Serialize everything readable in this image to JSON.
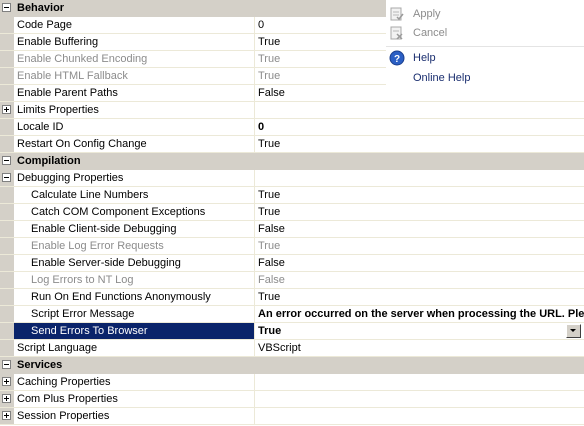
{
  "sections": {
    "behavior": {
      "title": "Behavior",
      "rows": [
        {
          "name": "Code Page",
          "value": "0"
        },
        {
          "name": "Enable Buffering",
          "value": "True"
        },
        {
          "name": "Enable Chunked Encoding",
          "value": "True"
        },
        {
          "name": "Enable HTML Fallback",
          "value": "True"
        },
        {
          "name": "Enable Parent Paths",
          "value": "False"
        },
        {
          "name": "Limits Properties",
          "value": ""
        },
        {
          "name": "Locale ID",
          "value": "0"
        },
        {
          "name": "Restart On Config Change",
          "value": "True"
        }
      ]
    },
    "compilation": {
      "title": "Compilation",
      "group": {
        "name": "Debugging Properties",
        "value": ""
      },
      "rows": [
        {
          "name": "Calculate Line Numbers",
          "value": "True"
        },
        {
          "name": "Catch COM Component Exceptions",
          "value": "True"
        },
        {
          "name": "Enable Client-side Debugging",
          "value": "False"
        },
        {
          "name": "Enable Log Error Requests",
          "value": "True"
        },
        {
          "name": "Enable Server-side Debugging",
          "value": "False"
        },
        {
          "name": "Log Errors to NT Log",
          "value": "False"
        },
        {
          "name": "Run On End Functions Anonymously",
          "value": "True"
        },
        {
          "name": "Script Error Message",
          "value": "An error occurred on the server when processing the URL. Please contact the system administrator."
        },
        {
          "name": "Send Errors To Browser",
          "value": "True"
        }
      ],
      "script_language": {
        "name": "Script Language",
        "value": "VBScript"
      }
    },
    "services": {
      "title": "Services",
      "rows": [
        {
          "name": "Caching Properties",
          "value": ""
        },
        {
          "name": "Com Plus Properties",
          "value": ""
        },
        {
          "name": "Session Properties",
          "value": ""
        }
      ]
    }
  },
  "actions": {
    "apply": "Apply",
    "cancel": "Cancel",
    "help": "Help",
    "online_help": "Online Help"
  },
  "colors": {
    "category_bg": "#d4d0c8",
    "selection_bg": "#0a246a",
    "disabled_text": "#8c8c8c",
    "link_text": "#1a2e6f"
  }
}
